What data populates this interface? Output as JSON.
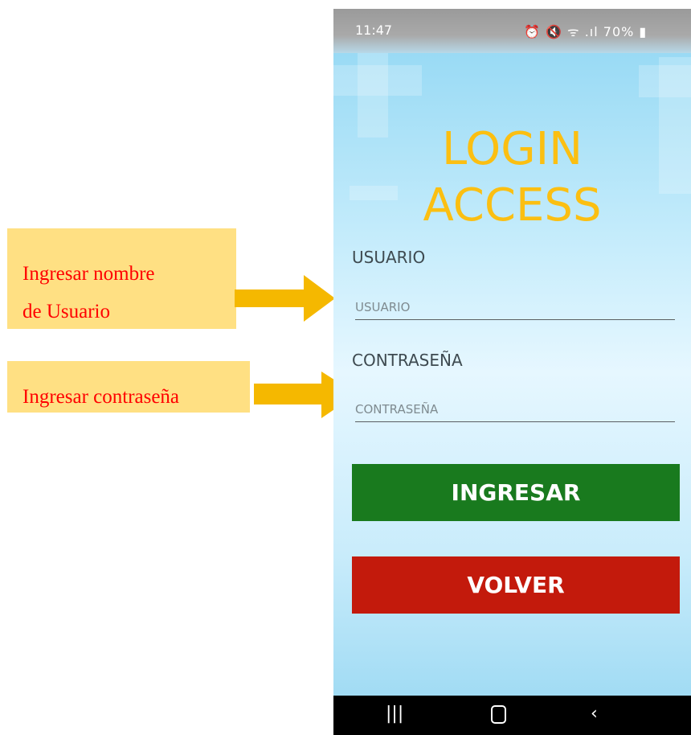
{
  "annotations": {
    "user_callout": [
      "Ingresar nombre",
      "de Usuario"
    ],
    "password_callout": "Ingresar contraseña"
  },
  "status_bar": {
    "time": "11:47",
    "icons": "⏰ 🔇 ᯤ .ıl 70% ▮",
    "battery": "70%"
  },
  "app": {
    "title_line1": "LOGIN",
    "title_line2": "ACCESS",
    "user_label": "USUARIO",
    "user_placeholder": "USUARIO",
    "password_label": "CONTRASEÑA",
    "password_placeholder": "CONTRASEÑA",
    "login_button": "INGRESAR",
    "back_button": "VOLVER"
  },
  "nav_bar": {
    "recents": "|||",
    "back": "‹"
  },
  "colors": {
    "title": "#fbbf12",
    "login_button": "#197a1e",
    "back_button": "#c31a0c",
    "callout_bg": "#ffe083",
    "callout_text": "#ff0000",
    "arrow": "#f5b800"
  }
}
